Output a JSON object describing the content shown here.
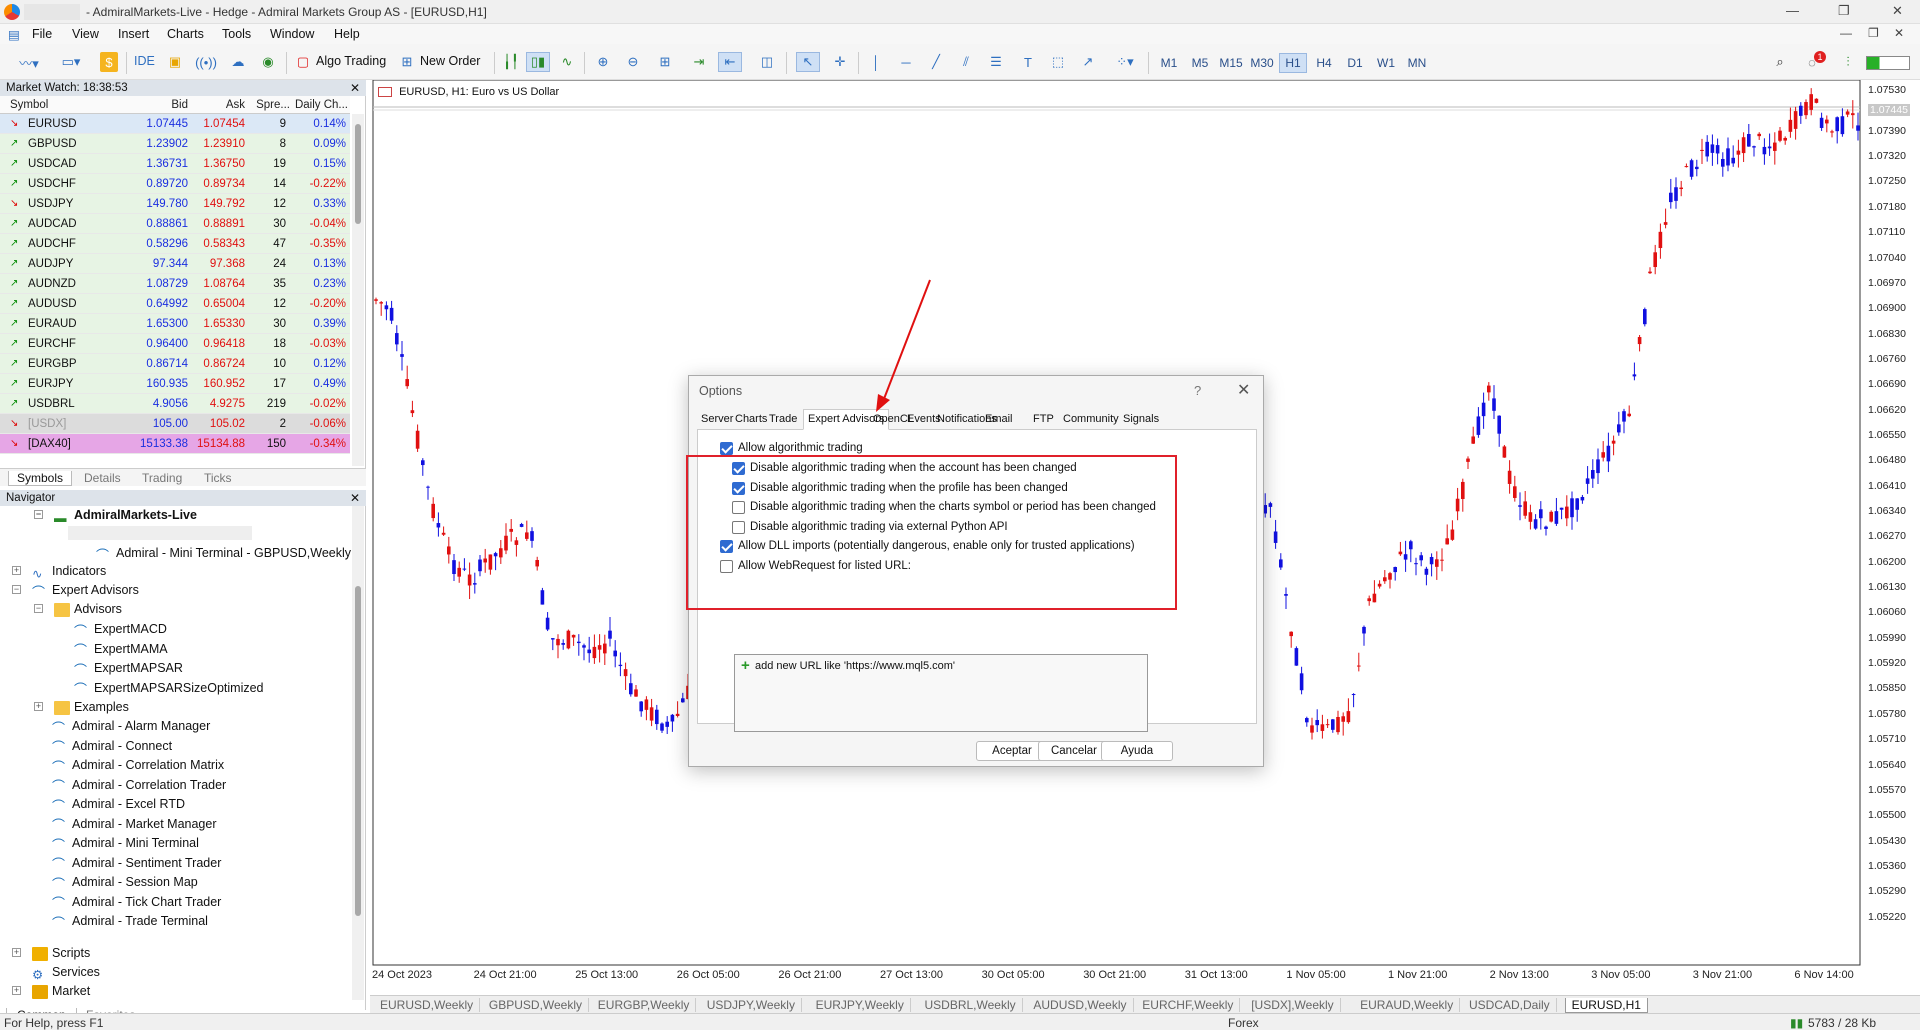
{
  "window": {
    "title": "- AdmiralMarkets-Live - Hedge - Admiral Markets Group AS - [EURUSD,H1]"
  },
  "menu": [
    "File",
    "View",
    "Insert",
    "Charts",
    "Tools",
    "Window",
    "Help"
  ],
  "toolbar": {
    "ide": "IDE",
    "algo_trading": "Algo Trading",
    "new_order": "New Order",
    "timeframes": [
      "M1",
      "M5",
      "M15",
      "M30",
      "H1",
      "H4",
      "D1",
      "W1",
      "MN"
    ],
    "active_timeframe": "H1",
    "notification_count": "1"
  },
  "market_watch": {
    "title": "Market Watch: 18:38:53",
    "columns": [
      "Symbol",
      "Bid",
      "Ask",
      "Spre...",
      "Daily Ch..."
    ],
    "rows": [
      {
        "symbol": "EURUSD",
        "bid": "1.07445",
        "ask": "1.07454",
        "spread": "9",
        "change": "0.14%",
        "dir": "down"
      },
      {
        "symbol": "GBPUSD",
        "bid": "1.23902",
        "ask": "1.23910",
        "spread": "8",
        "change": "0.09%",
        "dir": "up"
      },
      {
        "symbol": "USDCAD",
        "bid": "1.36731",
        "ask": "1.36750",
        "spread": "19",
        "change": "0.15%",
        "dir": "up"
      },
      {
        "symbol": "USDCHF",
        "bid": "0.89720",
        "ask": "0.89734",
        "spread": "14",
        "change": "-0.22%",
        "dir": "up"
      },
      {
        "symbol": "USDJPY",
        "bid": "149.780",
        "ask": "149.792",
        "spread": "12",
        "change": "0.33%",
        "dir": "down"
      },
      {
        "symbol": "AUDCAD",
        "bid": "0.88861",
        "ask": "0.88891",
        "spread": "30",
        "change": "-0.04%",
        "dir": "up"
      },
      {
        "symbol": "AUDCHF",
        "bid": "0.58296",
        "ask": "0.58343",
        "spread": "47",
        "change": "-0.35%",
        "dir": "up"
      },
      {
        "symbol": "AUDJPY",
        "bid": "97.344",
        "ask": "97.368",
        "spread": "24",
        "change": "0.13%",
        "dir": "up"
      },
      {
        "symbol": "AUDNZD",
        "bid": "1.08729",
        "ask": "1.08764",
        "spread": "35",
        "change": "0.23%",
        "dir": "up"
      },
      {
        "symbol": "AUDUSD",
        "bid": "0.64992",
        "ask": "0.65004",
        "spread": "12",
        "change": "-0.20%",
        "dir": "up"
      },
      {
        "symbol": "EURAUD",
        "bid": "1.65300",
        "ask": "1.65330",
        "spread": "30",
        "change": "0.39%",
        "dir": "up"
      },
      {
        "symbol": "EURCHF",
        "bid": "0.96400",
        "ask": "0.96418",
        "spread": "18",
        "change": "-0.03%",
        "dir": "up"
      },
      {
        "symbol": "EURGBP",
        "bid": "0.86714",
        "ask": "0.86724",
        "spread": "10",
        "change": "0.12%",
        "dir": "up"
      },
      {
        "symbol": "EURJPY",
        "bid": "160.935",
        "ask": "160.952",
        "spread": "17",
        "change": "0.49%",
        "dir": "up"
      },
      {
        "symbol": "USDBRL",
        "bid": "4.9056",
        "ask": "4.9275",
        "spread": "219",
        "change": "-0.02%",
        "dir": "up"
      },
      {
        "symbol": "[USDX]",
        "bid": "105.00",
        "ask": "105.02",
        "spread": "2",
        "change": "-0.06%",
        "dir": "down"
      },
      {
        "symbol": "[DAX40]",
        "bid": "15133.38",
        "ask": "15134.88",
        "spread": "150",
        "change": "-0.34%",
        "dir": "down"
      }
    ],
    "tabs": [
      "Symbols",
      "Details",
      "Trading",
      "Ticks"
    ]
  },
  "navigator": {
    "title": "Navigator",
    "account": "AdmiralMarkets-Live",
    "mini_terminal": "Admiral - Mini Terminal - GBPUSD,Weekly",
    "indicators": "Indicators",
    "expert_advisors": "Expert Advisors",
    "advisors": "Advisors",
    "advisor_items": [
      "ExpertMACD",
      "ExpertMAMA",
      "ExpertMAPSAR",
      "ExpertMAPSARSizeOptimized"
    ],
    "examples": "Examples",
    "admiral_items": [
      "Admiral - Alarm Manager",
      "Admiral - Connect",
      "Admiral - Correlation Matrix",
      "Admiral - Correlation Trader",
      "Admiral - Excel RTD",
      "Admiral - Market Manager",
      "Admiral - Mini Terminal",
      "Admiral - Sentiment Trader",
      "Admiral - Session Map",
      "Admiral - Tick Chart Trader",
      "Admiral - Trade Terminal"
    ],
    "scripts": "Scripts",
    "services": "Services",
    "market": "Market",
    "tabs": [
      "Common",
      "Favorites"
    ]
  },
  "chart": {
    "title": "EURUSD, H1:  Euro vs US Dollar",
    "price_labels": [
      "1.07530",
      "1.07445",
      "1.07390",
      "1.07320",
      "1.07250",
      "1.07180",
      "1.07110",
      "1.07040",
      "1.06970",
      "1.06900",
      "1.06830",
      "1.06760",
      "1.06690",
      "1.06620",
      "1.06550",
      "1.06480",
      "1.06410",
      "1.06340",
      "1.06270",
      "1.06200",
      "1.06130",
      "1.06060",
      "1.05990",
      "1.05920",
      "1.05850",
      "1.05780",
      "1.05710",
      "1.05640",
      "1.05570",
      "1.05500",
      "1.05430",
      "1.05360",
      "1.05290",
      "1.05220"
    ],
    "time_labels": [
      "24 Oct 2023",
      "24 Oct 21:00",
      "25 Oct 13:00",
      "26 Oct 05:00",
      "26 Oct 21:00",
      "27 Oct 13:00",
      "30 Oct 05:00",
      "30 Oct 21:00",
      "31 Oct 13:00",
      "1 Nov 05:00",
      "1 Nov 21:00",
      "2 Nov 13:00",
      "3 Nov 05:00",
      "3 Nov 21:00",
      "6 Nov 14:00"
    ],
    "tabs": [
      "EURUSD,Weekly",
      "GBPUSD,Weekly",
      "EURGBP,Weekly",
      "USDJPY,Weekly",
      "EURJPY,Weekly",
      "USDBRL,Weekly",
      "AUDUSD,Weekly",
      "EURCHF,Weekly",
      "[USDX],Weekly",
      "EURAUD,Weekly",
      "USDCAD,Daily",
      "EURUSD,H1"
    ],
    "bull_color": "#1010e0",
    "bear_color": "#e01010"
  },
  "dialog": {
    "title": "Options",
    "help_glyph": "?",
    "tabs": [
      "Server",
      "Charts",
      "Trade",
      "Expert Advisors",
      "OpenCL",
      "Events",
      "Notifications",
      "Email",
      "FTP",
      "Community",
      "Signals"
    ],
    "active_tab": "Expert Advisors",
    "options": [
      {
        "label": "Allow algorithmic trading",
        "checked": true
      },
      {
        "label": "Disable algorithmic trading when the account has been changed",
        "checked": true
      },
      {
        "label": "Disable algorithmic trading when the profile has been changed",
        "checked": true
      },
      {
        "label": "Disable algorithmic trading when the charts symbol or period has been changed",
        "checked": false
      },
      {
        "label": "Disable algorithmic trading via external Python API",
        "checked": false
      },
      {
        "label": "Allow DLL imports (potentially dangerous, enable only for trusted applications)",
        "checked": true
      },
      {
        "label": "Allow WebRequest for listed URL:",
        "checked": false
      }
    ],
    "url_placeholder": "add new URL like 'https://www.mql5.com'",
    "buttons": {
      "ok": "Aceptar",
      "cancel": "Cancelar",
      "help": "Ayuda"
    }
  },
  "status": {
    "help": "For Help, press F1",
    "market": "Forex",
    "traffic": "5783 / 28 Kb"
  }
}
